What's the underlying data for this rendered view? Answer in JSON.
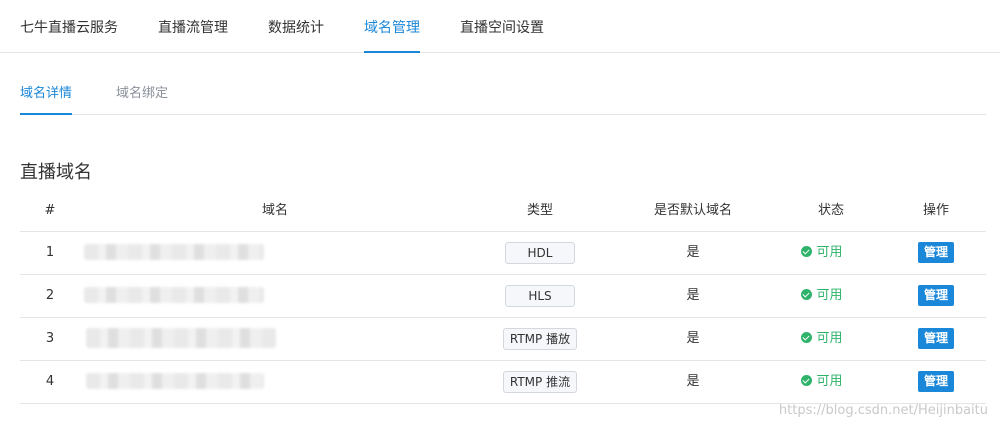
{
  "top_nav": {
    "tabs": [
      {
        "label": "七牛直播云服务"
      },
      {
        "label": "直播流管理"
      },
      {
        "label": "数据统计"
      },
      {
        "label": "域名管理"
      },
      {
        "label": "直播空间设置"
      }
    ],
    "active": "域名管理"
  },
  "sub_nav": {
    "tabs": [
      {
        "label": "域名详情"
      },
      {
        "label": "域名绑定"
      }
    ],
    "active": "域名详情"
  },
  "section_title": "直播域名",
  "table": {
    "headers": {
      "index": "#",
      "domain": "域名",
      "type": "类型",
      "default": "是否默认域名",
      "status": "状态",
      "action": "操作"
    },
    "rows": [
      {
        "index": "1",
        "type": "HDL",
        "default": "是",
        "status": "可用",
        "action": "管理"
      },
      {
        "index": "2",
        "type": "HLS",
        "default": "是",
        "status": "可用",
        "action": "管理"
      },
      {
        "index": "3",
        "type": "RTMP 播放",
        "default": "是",
        "status": "可用",
        "action": "管理"
      },
      {
        "index": "4",
        "type": "RTMP 推流",
        "default": "是",
        "status": "可用",
        "action": "管理"
      }
    ]
  },
  "colors": {
    "accent": "#1b87d8",
    "status_ok": "#2fb36b"
  },
  "icons": {
    "status": "check-circle-icon"
  },
  "watermark": "https://blog.csdn.net/Heijinbaitu"
}
